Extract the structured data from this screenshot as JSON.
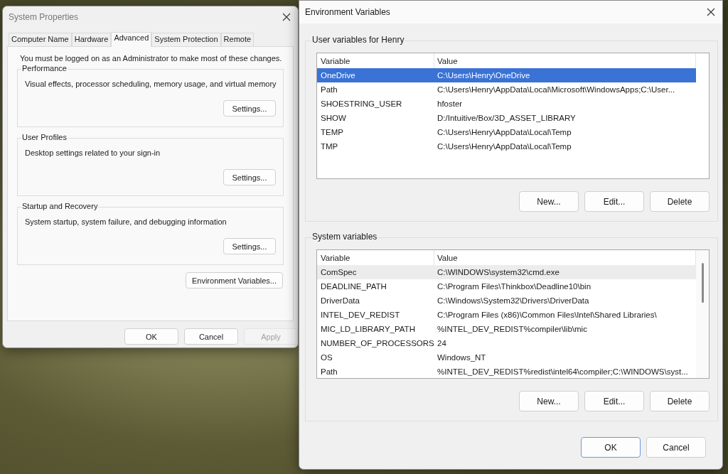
{
  "system_properties": {
    "title": "System Properties",
    "tabs": [
      {
        "label": "Computer Name",
        "selected": false
      },
      {
        "label": "Hardware",
        "selected": false
      },
      {
        "label": "Advanced",
        "selected": true
      },
      {
        "label": "System Protection",
        "selected": false
      },
      {
        "label": "Remote",
        "selected": false
      }
    ],
    "notice": "You must be logged on as an Administrator to make most of these changes.",
    "groups": [
      {
        "title": "Performance",
        "description": "Visual effects, processor scheduling, memory usage, and virtual memory",
        "button": "Settings..."
      },
      {
        "title": "User Profiles",
        "description": "Desktop settings related to your sign-in",
        "button": "Settings..."
      },
      {
        "title": "Startup and Recovery",
        "description": "System startup, system failure, and debugging information",
        "button": "Settings..."
      }
    ],
    "environment_button": "Environment Variables...",
    "buttons": [
      {
        "label": "OK",
        "disabled": false
      },
      {
        "label": "Cancel",
        "disabled": false
      },
      {
        "label": "Apply",
        "disabled": true
      }
    ]
  },
  "environment_variables": {
    "title": "Environment Variables",
    "sections": [
      {
        "title": "User variables for Henry",
        "focused": true,
        "scrollbar": false,
        "columns": [
          "Variable",
          "Value"
        ],
        "rows": [
          {
            "variable": "OneDrive",
            "value": "C:\\Users\\Henry\\OneDrive",
            "selected": true
          },
          {
            "variable": "Path",
            "value": "C:\\Users\\Henry\\AppData\\Local\\Microsoft\\WindowsApps;C:\\User...",
            "selected": false
          },
          {
            "variable": "SHOESTRING_USER",
            "value": "hfoster",
            "selected": false
          },
          {
            "variable": "SHOW",
            "value": "D:/Intuitive/Box/3D_ASSET_LIBRARY",
            "selected": false
          },
          {
            "variable": "TEMP",
            "value": "C:\\Users\\Henry\\AppData\\Local\\Temp",
            "selected": false
          },
          {
            "variable": "TMP",
            "value": "C:\\Users\\Henry\\AppData\\Local\\Temp",
            "selected": false
          }
        ],
        "buttons": [
          "New...",
          "Edit...",
          "Delete"
        ]
      },
      {
        "title": "System variables",
        "focused": false,
        "scrollbar": true,
        "columns": [
          "Variable",
          "Value"
        ],
        "rows": [
          {
            "variable": "ComSpec",
            "value": "C:\\WINDOWS\\system32\\cmd.exe",
            "selected": true
          },
          {
            "variable": "DEADLINE_PATH",
            "value": "C:\\Program Files\\Thinkbox\\Deadline10\\bin",
            "selected": false
          },
          {
            "variable": "DriverData",
            "value": "C:\\Windows\\System32\\Drivers\\DriverData",
            "selected": false
          },
          {
            "variable": "INTEL_DEV_REDIST",
            "value": "C:\\Program Files (x86)\\Common Files\\Intel\\Shared Libraries\\",
            "selected": false
          },
          {
            "variable": "MIC_LD_LIBRARY_PATH",
            "value": "%INTEL_DEV_REDIST%compiler\\lib\\mic",
            "selected": false
          },
          {
            "variable": "NUMBER_OF_PROCESSORS",
            "value": "24",
            "selected": false
          },
          {
            "variable": "OS",
            "value": "Windows_NT",
            "selected": false
          },
          {
            "variable": "Path",
            "value": "%INTEL_DEV_REDIST%redist\\intel64\\compiler;C:\\WINDOWS\\syst...",
            "selected": false
          }
        ],
        "buttons": [
          "New...",
          "Edit...",
          "Delete"
        ]
      }
    ],
    "buttons": [
      {
        "label": "OK",
        "default": true
      },
      {
        "label": "Cancel",
        "default": false
      }
    ]
  }
}
